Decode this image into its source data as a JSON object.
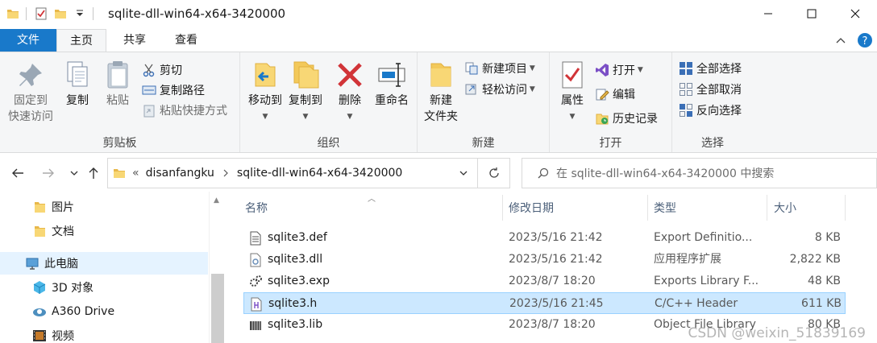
{
  "window": {
    "title": "sqlite-dll-win64-x64-3420000"
  },
  "ribbon_tabs": {
    "file": "文件",
    "home": "主页",
    "share": "共享",
    "view": "查看"
  },
  "clipboard": {
    "pin_quick_access": "固定到\n快速访问",
    "pin_line1": "固定到",
    "pin_line2": "快速访问",
    "copy": "复制",
    "paste": "粘贴",
    "cut": "剪切",
    "copy_path": "复制路径",
    "paste_shortcut": "粘贴快捷方式",
    "label": "剪贴板"
  },
  "organize": {
    "move_to": "移动到",
    "copy_to": "复制到",
    "delete": "删除",
    "rename": "重命名",
    "label": "组织"
  },
  "new_group": {
    "new_folder_line1": "新建",
    "new_folder_line2": "文件夹",
    "new_item": "新建项目",
    "easy_access": "轻松访问",
    "label": "新建"
  },
  "open_group": {
    "properties": "属性",
    "open": "打开",
    "edit": "编辑",
    "history": "历史记录",
    "label": "打开"
  },
  "select_group": {
    "select_all": "全部选择",
    "select_none": "全部取消",
    "invert": "反向选择",
    "label": "选择"
  },
  "address": {
    "crumb_prefix": "«",
    "crumb_1": "disanfangku",
    "crumb_2": "sqlite-dll-win64-x64-3420000",
    "search_placeholder": "在 sqlite-dll-win64-x64-3420000 中搜索"
  },
  "nav": {
    "items": [
      {
        "label": "图片",
        "icon": "folder-icon"
      },
      {
        "label": "文档",
        "icon": "folder-icon"
      },
      {
        "label": "此电脑",
        "icon": "computer-icon"
      },
      {
        "label": "3D 对象",
        "icon": "3d-objects-icon"
      },
      {
        "label": "A360 Drive",
        "icon": "a360-drive-icon"
      },
      {
        "label": "视频",
        "icon": "video-icon"
      }
    ]
  },
  "columns": {
    "name": "名称",
    "modified": "修改日期",
    "type": "类型",
    "size": "大小"
  },
  "files": [
    {
      "name": "sqlite3.def",
      "modified": "2023/5/16 21:42",
      "type": "Export Definitio...",
      "size": "8 KB",
      "icon": "text-file-icon"
    },
    {
      "name": "sqlite3.dll",
      "modified": "2023/5/16 21:42",
      "type": "应用程序扩展",
      "size": "2,822 KB",
      "icon": "dll-file-icon"
    },
    {
      "name": "sqlite3.exp",
      "modified": "2023/8/7 18:20",
      "type": "Exports Library F...",
      "size": "48 KB",
      "icon": "exp-file-icon"
    },
    {
      "name": "sqlite3.h",
      "modified": "2023/5/16 21:45",
      "type": "C/C++ Header",
      "size": "611 KB",
      "icon": "header-file-icon",
      "selected": true
    },
    {
      "name": "sqlite3.lib",
      "modified": "2023/8/7 18:20",
      "type": "Object File Library",
      "size": "80 KB",
      "icon": "lib-file-icon"
    }
  ],
  "watermark": "CSDN @weixin_51839169",
  "colors": {
    "accent": "#1979ca",
    "selection": "#cce8ff",
    "ribbon_bg": "#f5f6f7"
  }
}
